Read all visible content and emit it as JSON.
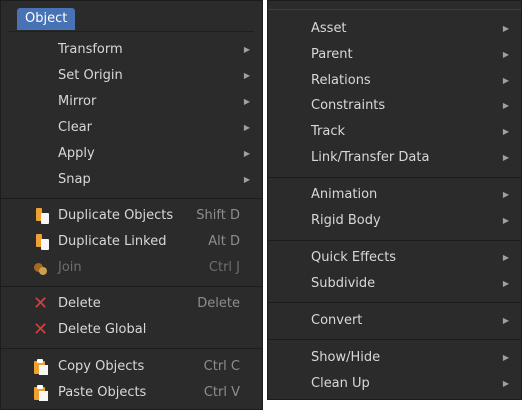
{
  "object_menu": {
    "title": "Object",
    "items": [
      {
        "label": "Transform",
        "has_submenu": true
      },
      {
        "label": "Set Origin",
        "has_submenu": true
      },
      {
        "label": "Mirror",
        "has_submenu": true
      },
      {
        "label": "Clear",
        "has_submenu": true
      },
      {
        "label": "Apply",
        "has_submenu": true
      },
      {
        "label": "Snap",
        "has_submenu": true
      },
      {
        "label": "Duplicate Objects",
        "shortcut": "Shift D",
        "icon": "duplicate-icon"
      },
      {
        "label": "Duplicate Linked",
        "shortcut": "Alt D",
        "icon": "duplicate-linked-icon"
      },
      {
        "label": "Join",
        "shortcut": "Ctrl J",
        "icon": "join-icon",
        "disabled": true
      },
      {
        "label": "Delete",
        "shortcut": "Delete",
        "icon": "delete-x-icon"
      },
      {
        "label": "Delete Global",
        "icon": "delete-x-icon"
      },
      {
        "label": "Copy Objects",
        "shortcut": "Ctrl C",
        "icon": "copy-clipboard-icon"
      },
      {
        "label": "Paste Objects",
        "shortcut": "Ctrl V",
        "icon": "paste-clipboard-icon"
      }
    ]
  },
  "object_submenus": {
    "items": [
      {
        "label": "Asset"
      },
      {
        "label": "Parent"
      },
      {
        "label": "Relations"
      },
      {
        "label": "Constraints"
      },
      {
        "label": "Track"
      },
      {
        "label": "Link/Transfer Data"
      },
      {
        "label": "Animation"
      },
      {
        "label": "Rigid Body"
      },
      {
        "label": "Quick Effects"
      },
      {
        "label": "Subdivide"
      },
      {
        "label": "Convert"
      },
      {
        "label": "Show/Hide"
      },
      {
        "label": "Clean Up"
      }
    ],
    "submenu_arrow": "▶"
  },
  "colors": {
    "menu_background": "#2b2b2b",
    "header_accent": "#4772b3",
    "text": "#d8d8d8",
    "shortcut_text": "#8e8e8e",
    "disabled_text": "#6f6f6f",
    "delete_icon": "#e23a3a",
    "icon_orange": "#f0a030"
  }
}
